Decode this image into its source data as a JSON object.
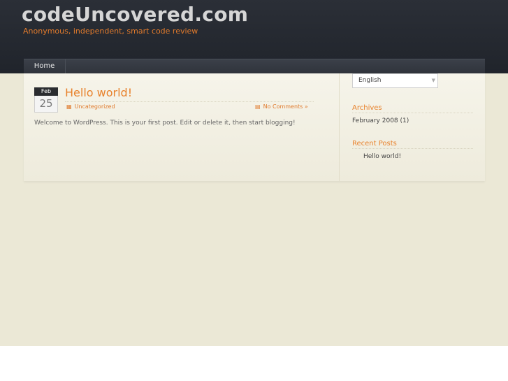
{
  "site": {
    "title": "codeUncovered.com",
    "tagline": "Anonymous, independent, smart code review"
  },
  "nav": {
    "items": [
      {
        "label": "Home"
      }
    ]
  },
  "post": {
    "date_month": "Feb",
    "date_day": "25",
    "title": "Hello world!",
    "category": "Uncategorized",
    "comments": "No Comments »",
    "body": "Welcome to WordPress. This is your first post. Edit or delete it, then start blogging!"
  },
  "sidebar": {
    "language": {
      "value": "English"
    },
    "archives": {
      "title": "Archives",
      "items": [
        {
          "label": "February 2008",
          "count": "(1)"
        }
      ]
    },
    "recent_posts": {
      "title": "Recent Posts",
      "items": [
        {
          "label": "Hello world!"
        }
      ]
    }
  },
  "icons": {
    "category": "folder-icon",
    "comments": "comment-icon",
    "dropdown": "chevron-down-icon"
  },
  "colors": {
    "accent": "#e07a2c",
    "header_bg": "#23272e",
    "page_bg": "#ebe8d6"
  }
}
